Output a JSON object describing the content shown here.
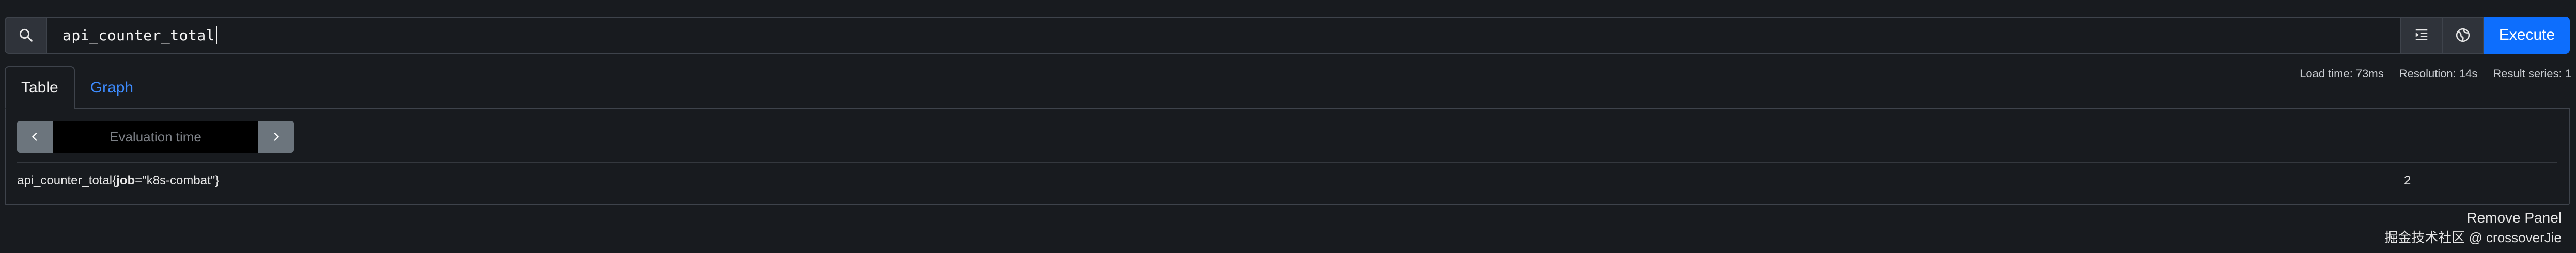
{
  "query": {
    "value": "api_counter_total",
    "execute_label": "Execute",
    "search_icon": "search-icon",
    "format_icon": "indent-icon",
    "explore_icon": "globe-icon"
  },
  "tabs": [
    {
      "label": "Table",
      "active": true
    },
    {
      "label": "Graph",
      "active": false
    }
  ],
  "stats": {
    "load_time": "Load time: 73ms",
    "resolution": "Resolution: 14s",
    "result_series": "Result series: 1"
  },
  "table": {
    "evaluation_placeholder": "Evaluation time",
    "rows": [
      {
        "metric_name": "api_counter_total",
        "label_open": "{",
        "label_key": "job",
        "label_eq": "=\"",
        "label_value": "k8s-combat",
        "label_close": "\"}",
        "value": "2"
      }
    ]
  },
  "footer": {
    "remove_panel": "Remove Panel",
    "watermark": "掘金技术社区 @ crossoverJie"
  },
  "colors": {
    "background": "#181b1f",
    "accent": "#0d6efd",
    "link": "#3d8bfd",
    "border": "#3e434b"
  }
}
